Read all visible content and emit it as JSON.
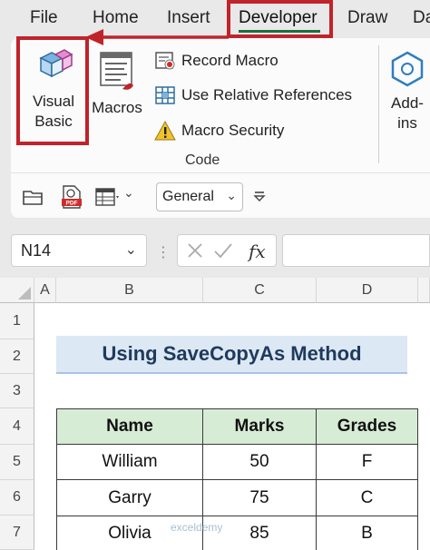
{
  "menu": {
    "tabs": [
      "File",
      "Home",
      "Insert",
      "Developer",
      "Draw",
      "Da"
    ]
  },
  "ribbon": {
    "visual_basic": "Visual Basic",
    "visual_basic_line1": "Visual",
    "visual_basic_line2": "Basic",
    "macros": "Macros",
    "record_macro": "Record Macro",
    "relative_refs": "Use Relative References",
    "macro_security": "Macro Security",
    "group_code": "Code",
    "addins_line1": "Add-",
    "addins_line2": "ins"
  },
  "qat": {
    "number_format": "General"
  },
  "formula_bar": {
    "name_box": "N14",
    "fx": "fx"
  },
  "sheet": {
    "columns": [
      "A",
      "B",
      "C",
      "D"
    ],
    "rows": [
      "1",
      "2",
      "3",
      "4",
      "5",
      "6",
      "7"
    ],
    "title": "Using SaveCopyAs Method",
    "table": {
      "headers": [
        "Name",
        "Marks",
        "Grades"
      ],
      "rows": [
        [
          "William",
          "50",
          "F"
        ],
        [
          "Garry",
          "75",
          "C"
        ],
        [
          "Olivia",
          "85",
          "B"
        ]
      ]
    }
  },
  "watermark": "exceldemy",
  "colors": {
    "accent_green": "#1e6e3c",
    "highlight_red": "#c0232a",
    "title_fill": "#dde8f5",
    "header_fill": "#d7ecd5"
  },
  "icons": [
    "visual-basic-icon",
    "macros-icon",
    "record-macro-icon",
    "relative-references-icon",
    "macro-security-icon",
    "add-ins-icon",
    "open-icon",
    "pdf-icon",
    "table-format-icon",
    "customize-qat-icon",
    "cancel-icon",
    "enter-icon"
  ]
}
